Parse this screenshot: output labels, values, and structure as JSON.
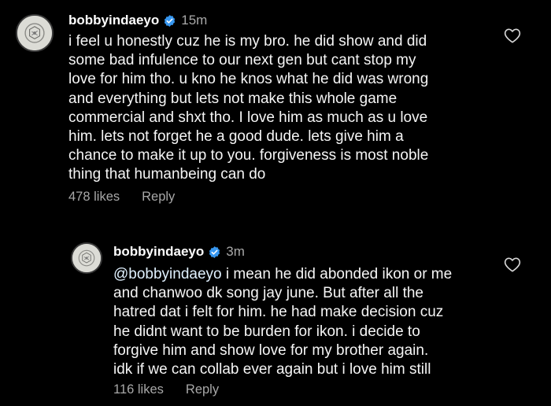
{
  "comments": [
    {
      "username": "bobbyindaeyo",
      "verified": true,
      "time": "15m",
      "mention": "",
      "text": "i feel u honestly cuz he is my bro. he did show and did\nsome bad infulence to our next gen but cant stop my\nlove for him tho. u kno he knos what he did was wrong\nand everything but lets not make this whole game\ncommercial and shxt tho. I love him as much as u love\nhim. lets not forget he a good dude. lets give him a\nchance to make it up to you. forgiveness is most noble\nthing that humanbeing can do",
      "likes": "478 likes",
      "reply_label": "Reply",
      "avatar_icon": "avatar-image",
      "like_icon": "heart-icon"
    },
    {
      "username": "bobbyindaeyo",
      "verified": true,
      "time": "3m",
      "mention": "@bobbyindaeyo",
      "text": " i mean he did abonded ikon or me\nand chanwoo dk song jay  june. But after all the\nhatred dat i felt for him. he had make decision cuz\nhe didnt want to be burden for ikon. i decide to\nforgive him and show love for my brother again.\nidk if we can collab ever again but i love him still",
      "likes": "116 likes",
      "reply_label": "Reply",
      "avatar_icon": "avatar-image",
      "like_icon": "heart-icon"
    }
  ],
  "colors": {
    "background": "#000000",
    "text": "#f5f5f5",
    "secondary": "#a8a8a8",
    "verified_badge": "#3797f0",
    "mention": "#e0f1ff"
  }
}
